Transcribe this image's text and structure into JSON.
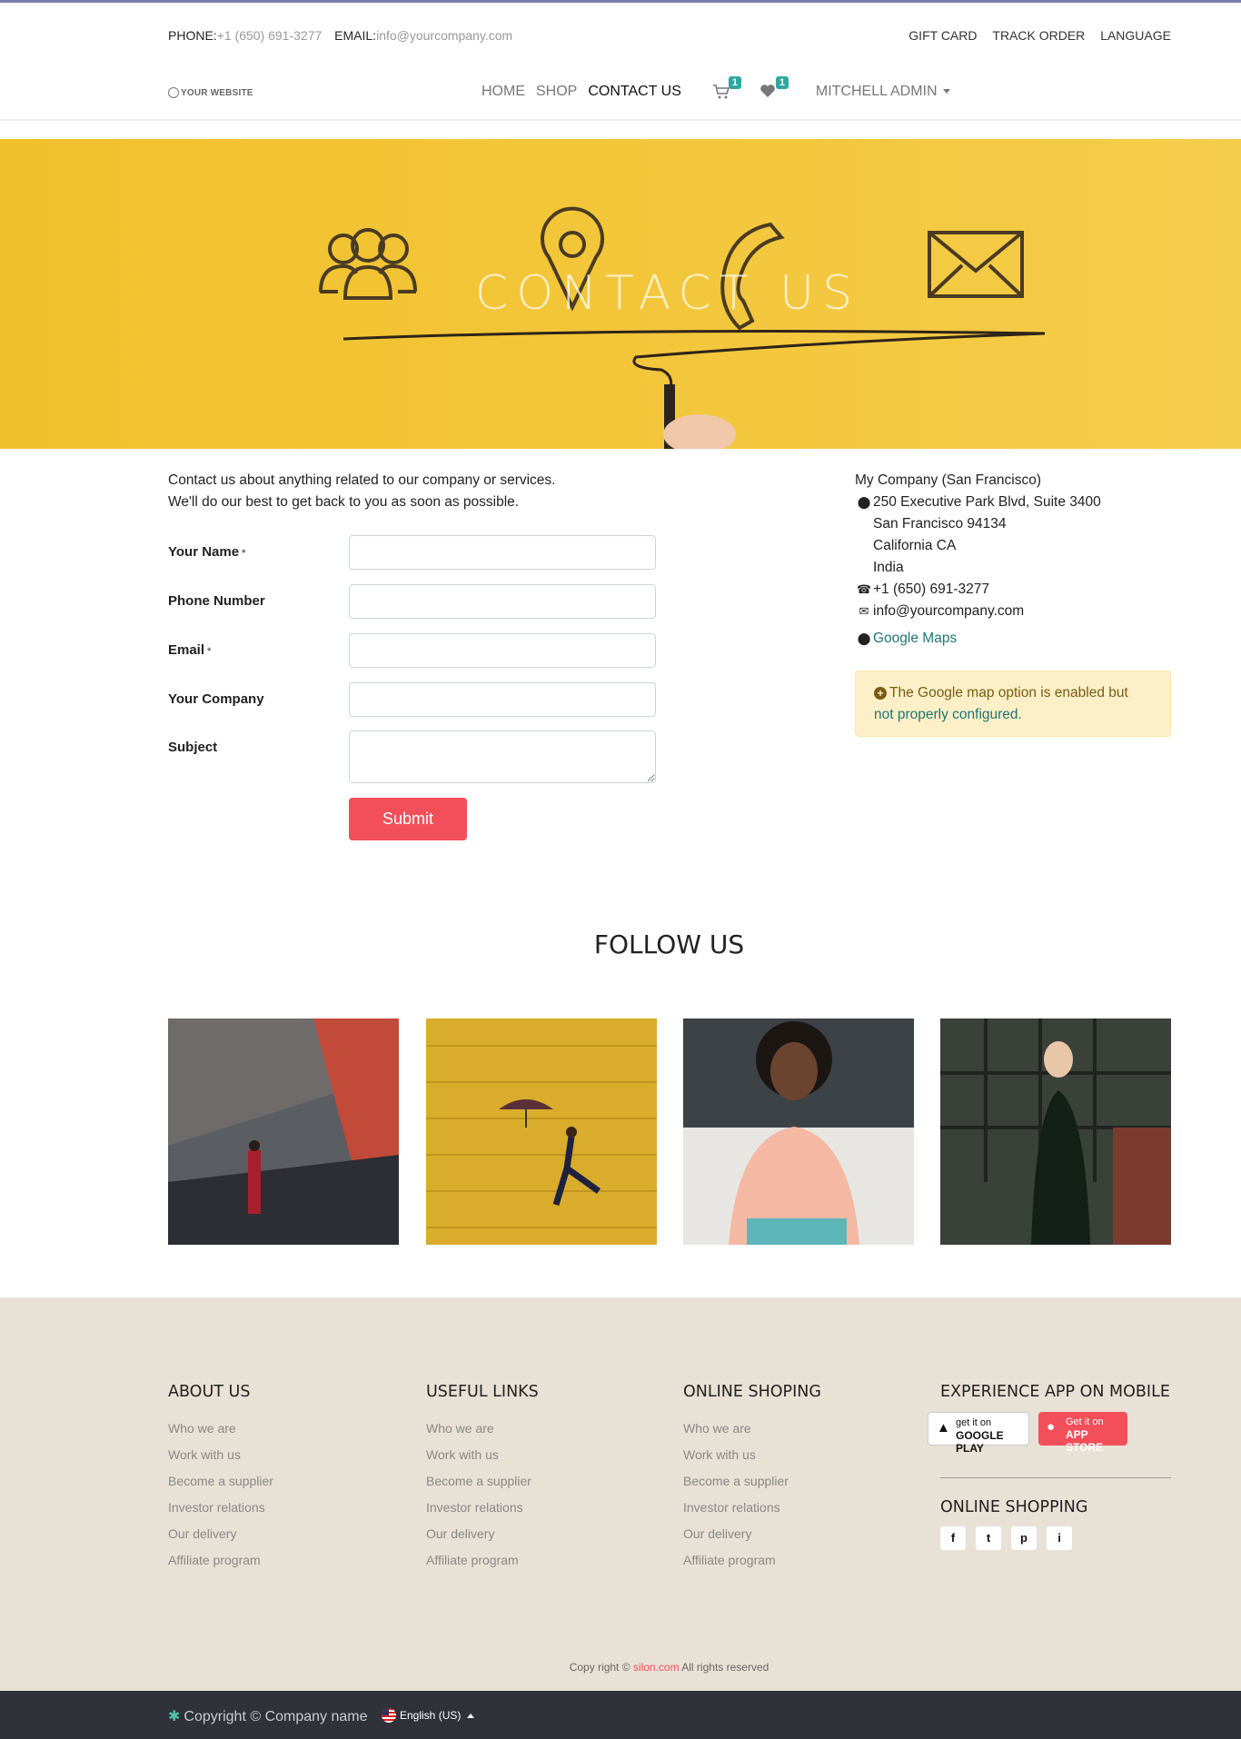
{
  "topbar": {
    "phone_label": "PHONE:",
    "phone_value": "+1 (650) 691-3277",
    "email_label": "EMAIL:",
    "email_value": "info@yourcompany.com",
    "links": [
      "GIFT CARD",
      "TRACK ORDER",
      "LANGUAGE"
    ]
  },
  "nav": {
    "logo_text": "YOUR WEBSITE",
    "items": [
      "HOME",
      "SHOP",
      "CONTACT US"
    ],
    "active": "CONTACT US",
    "cart_count": "1",
    "wishlist_count": "1",
    "user": "MITCHELL ADMIN"
  },
  "hero": {
    "title": "CONTACT US",
    "background_color": "#f3c63a"
  },
  "contact": {
    "intro_line1": "Contact us about anything related to our company or services.",
    "intro_line2": "We'll do our best to get back to you as soon as possible.",
    "fields": [
      {
        "label": "Your Name",
        "required": "*"
      },
      {
        "label": "Phone Number",
        "required": ""
      },
      {
        "label": "Email",
        "required": "*"
      },
      {
        "label": "Your Company",
        "required": ""
      },
      {
        "label": "Subject",
        "required": ""
      }
    ],
    "submit_label": "Submit"
  },
  "address": {
    "company": "My Company (San Francisco)",
    "street": "250 Executive Park Blvd, Suite 3400",
    "city": "San Francisco 94134",
    "state": "California CA",
    "country": "India",
    "phone": "+1 (650) 691-3277",
    "email": "info@yourcompany.com",
    "maps_link": "Google Maps",
    "alert_text": "The Google map option is enabled but",
    "alert_link": "not properly configured."
  },
  "follow": {
    "title": "FOLLOW US"
  },
  "footer": {
    "columns": [
      {
        "title": "ABOUT US",
        "links": [
          "Who we are",
          "Work with us",
          "Become a supplier",
          "Investor relations",
          "Our delivery",
          "Affiliate program"
        ]
      },
      {
        "title": "USEFUL LINKS",
        "links": [
          "Who we are",
          "Work with us",
          "Become a supplier",
          "Investor relations",
          "Our delivery",
          "Affiliate program"
        ]
      },
      {
        "title": "ONLINE SHOPING",
        "links": [
          "Who we are",
          "Work with us",
          "Become a supplier",
          "Investor relations",
          "Our delivery",
          "Affiliate program"
        ]
      }
    ],
    "mobile_title": "EXPERIENCE APP ON MOBILE",
    "google_play_small": "get it on",
    "google_play_big": "GOOGLE PLAY",
    "app_store_small": "Get it on",
    "app_store_big": "APP STORE",
    "shopping_title": "ONLINE SHOPPING",
    "social": [
      "f",
      "t",
      "p",
      "i"
    ],
    "copyright_prefix": "Copy right ©",
    "copyright_brand": "silon.com",
    "copyright_suffix": "All rights reserved"
  },
  "bottom_bar": {
    "copyright": "Copyright © Company name",
    "language": "English (US)"
  },
  "colors": {
    "accent": "#f24f5b",
    "teal": "#2fa7a0",
    "footer_bg": "#e8e1d6",
    "bottom_bg": "#2f3238"
  }
}
